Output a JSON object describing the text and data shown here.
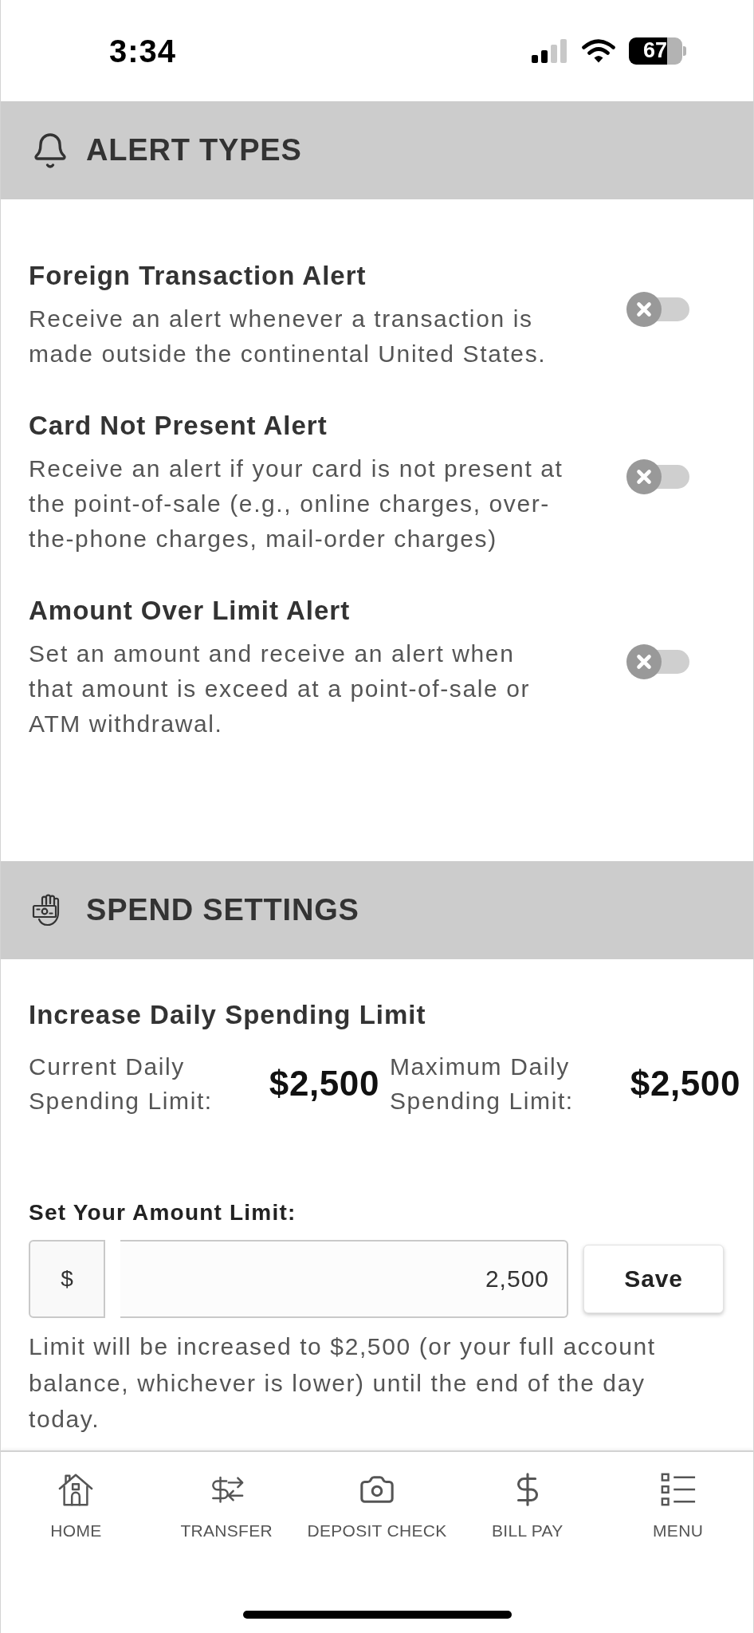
{
  "status_bar": {
    "time": "3:34",
    "battery": "67"
  },
  "alert_types": {
    "title": "ALERT TYPES",
    "alerts": [
      {
        "title": "Foreign Transaction Alert",
        "description": "Receive an alert whenever a transaction is made outside the continental United States.",
        "on": false
      },
      {
        "title": "Card Not Present Alert",
        "description": "Receive an alert if your card is not present at the point-of-sale (e.g., online charges, over-the-phone charges, mail-order charges)",
        "on": false
      },
      {
        "title": "Amount Over Limit Alert",
        "description": "Set an amount and receive an alert when that amount is exceed at a point-of-sale or ATM withdrawal.",
        "on": false
      }
    ]
  },
  "spend_settings": {
    "title": "SPEND SETTINGS",
    "heading": "Increase Daily Spending Limit",
    "limits": [
      {
        "label": "Current Daily Spending Limit:",
        "amount": "$2,500"
      },
      {
        "label": "Maximum Daily Spending Limit:",
        "amount": "$2,500"
      }
    ],
    "amount_field": {
      "label": "Set Your Amount Limit:",
      "prefix": "$",
      "value": "2,500"
    },
    "save_button": "Save",
    "note": "Limit will be increased to $2,500 (or your full account balance, whichever is lower) until the end of the day today."
  },
  "tab_bar": [
    {
      "label": "HOME",
      "kind": "home"
    },
    {
      "label": "TRANSFER",
      "kind": "transfer"
    },
    {
      "label": "DEPOSIT CHECK",
      "kind": "camera"
    },
    {
      "label": "BILL PAY",
      "kind": "dollar"
    },
    {
      "label": "MENU",
      "kind": "menu"
    }
  ]
}
